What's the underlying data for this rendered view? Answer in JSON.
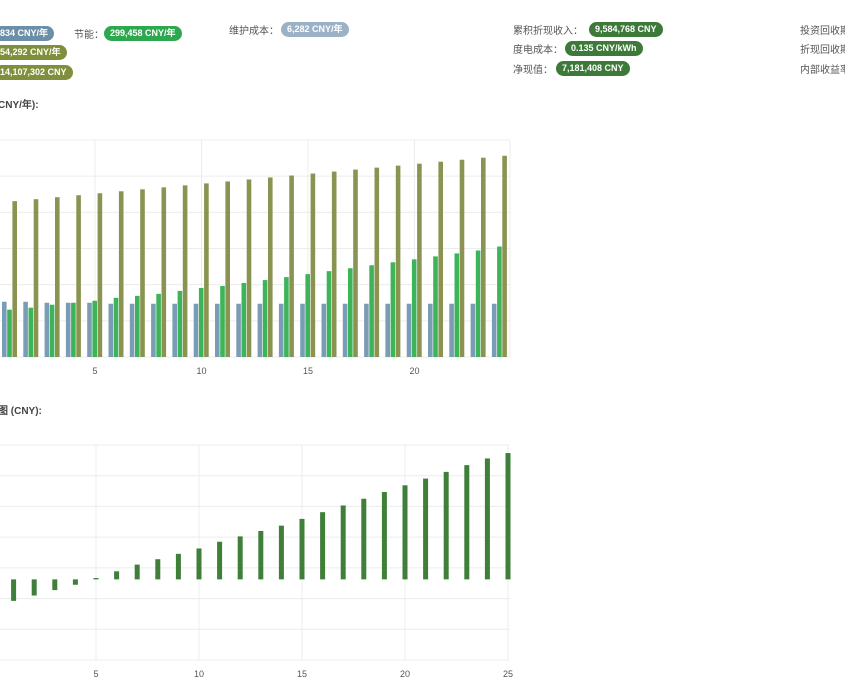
{
  "stats": {
    "col1": {
      "badge_top": "834 CNY/年",
      "badge_mid": "54,292 CNY/年",
      "badge_bot": "14,107,302 CNY"
    },
    "saving": {
      "label": "节能：",
      "value": "299,458 CNY/年"
    },
    "maintenance": {
      "label": "维护成本：",
      "value": "6,282 CNY/年"
    },
    "cum_discounted_income": {
      "label": "累积折现收入：",
      "value": "9,584,768 CNY"
    },
    "lcoe": {
      "label": "度电成本：",
      "value": "0.135 CNY/kWh"
    },
    "npv": {
      "label": "净现值：",
      "value": "7,181,408 CNY"
    },
    "right_labels": [
      "投资回收期",
      "折现回收期",
      "内部收益率"
    ]
  },
  "colors": {
    "slate": "#6c8fa8",
    "olive": "#7f8f3c",
    "green": "#2ea84f",
    "steel": "#9bb1c6",
    "dkgreen": "#3d7a3a"
  },
  "chart_data": [
    {
      "type": "bar",
      "title": "CNY/年):",
      "x": [
        1,
        2,
        3,
        4,
        5,
        6,
        7,
        8,
        9,
        10,
        11,
        12,
        13,
        14,
        15,
        16,
        17,
        18,
        19,
        20,
        21,
        22,
        23,
        24
      ],
      "x_ticks": [
        5,
        10,
        15,
        20
      ],
      "ylim": [
        0,
        220
      ],
      "grid": true,
      "series": [
        {
          "color": "#7a9cb5",
          "values": [
            56,
            56,
            55,
            55,
            55,
            54,
            54,
            54,
            54,
            54,
            54,
            54,
            54,
            54,
            54,
            54,
            54,
            54,
            54,
            54,
            54,
            54,
            54,
            54
          ]
        },
        {
          "color": "#3db35a",
          "values": [
            48,
            50,
            53,
            55,
            57,
            60,
            62,
            64,
            67,
            70,
            72,
            75,
            78,
            81,
            84,
            87,
            90,
            93,
            96,
            99,
            102,
            105,
            108,
            112
          ]
        },
        {
          "color": "#8a9450",
          "values": [
            158,
            160,
            162,
            164,
            166,
            168,
            170,
            172,
            174,
            176,
            178,
            180,
            182,
            184,
            186,
            188,
            190,
            192,
            194,
            196,
            198,
            200,
            202,
            204
          ]
        }
      ]
    },
    {
      "type": "bar",
      "title": "图 (CNY):",
      "x": [
        1,
        2,
        3,
        4,
        5,
        6,
        7,
        8,
        9,
        10,
        11,
        12,
        13,
        14,
        15,
        16,
        17,
        18,
        19,
        20,
        21,
        22,
        23,
        24,
        25
      ],
      "x_ticks": [
        5,
        10,
        15,
        20,
        25
      ],
      "ylim": [
        -3,
        5
      ],
      "grid": true,
      "series": [
        {
          "color": "#3f7f3a",
          "values": [
            -0.8,
            -0.6,
            -0.4,
            -0.2,
            0.05,
            0.3,
            0.55,
            0.75,
            0.95,
            1.15,
            1.4,
            1.6,
            1.8,
            2.0,
            2.25,
            2.5,
            2.75,
            3.0,
            3.25,
            3.5,
            3.75,
            4.0,
            4.25,
            4.5,
            4.7
          ]
        }
      ]
    }
  ]
}
